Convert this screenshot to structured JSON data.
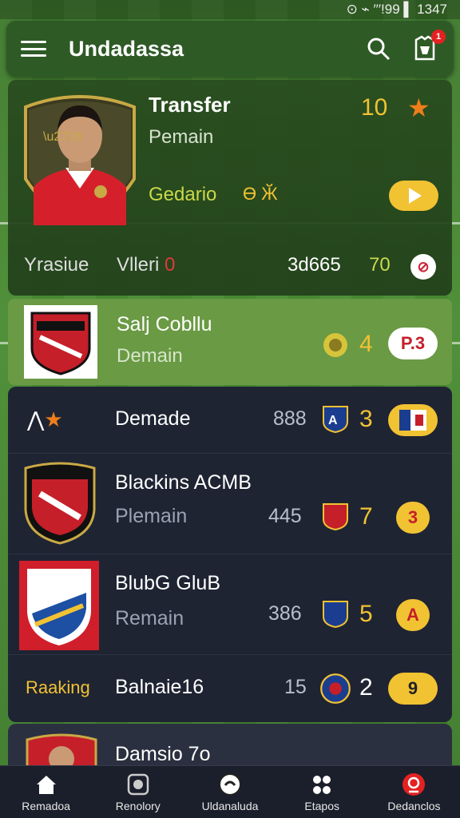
{
  "status_bar": {
    "text": "⊙ ⌁ ′′′!99 ▌ 1347"
  },
  "app_bar": {
    "title": "Undadassa",
    "notification_count": "1"
  },
  "player_card": {
    "title": "Transfer",
    "subtitle": "Pemain",
    "rating": "10",
    "club": "Gedario",
    "club_marks": "Ө Ӂ",
    "stats": {
      "label1": "Yrasiue",
      "label2": "Vlleri",
      "label2_suffix": "0",
      "value1": "3d665",
      "value2": "70"
    }
  },
  "highlight_club": {
    "name": "Salj Cobllu",
    "status": "Demain",
    "number": "4",
    "pill": "P.3"
  },
  "list": [
    {
      "title": "Demade",
      "value": "888",
      "number": "3"
    },
    {
      "title": "Blackins ACMB",
      "sub": "Plemain",
      "value": "445",
      "number": "7",
      "pill": "3"
    },
    {
      "title": "BlubG GluB",
      "sub": "Remain",
      "value": "386",
      "number": "5",
      "pill": "A"
    },
    {
      "label": "Raaking",
      "title": "Balnaie16",
      "value": "15",
      "number": "2",
      "pill": "9"
    }
  ],
  "next_card": {
    "title": "Damsio 7o"
  },
  "bottom_nav": [
    {
      "label": "Remadoa",
      "icon": "home-icon"
    },
    {
      "label": "Renolory",
      "icon": "shield-icon"
    },
    {
      "label": "Uldanaluda",
      "icon": "ball-icon"
    },
    {
      "label": "Etapos",
      "icon": "people-icon"
    },
    {
      "label": "Dedanclos",
      "icon": "club-icon"
    }
  ],
  "colors": {
    "accent": "#f1c232",
    "dark_panel": "#1f2433",
    "app_bar": "#2e5a26",
    "highlight": "#6a9a44",
    "star": "#ef7d1a"
  }
}
